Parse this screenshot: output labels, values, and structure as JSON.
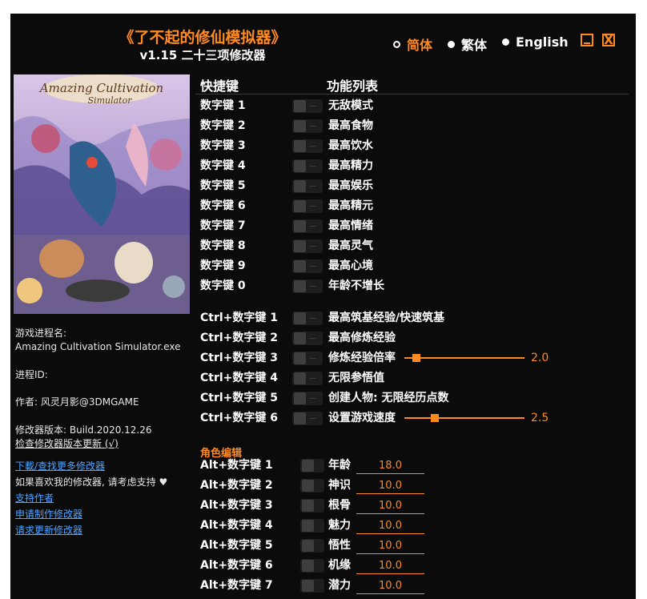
{
  "header": {
    "title": "《了不起的修仙模拟器》",
    "subtitle": "v1.15 二十三项修改器"
  },
  "languages": [
    "简体",
    "繁体",
    "English"
  ],
  "colors": {
    "accent": "#ff8a1e",
    "link": "#4fa3ff",
    "background": "#0b0b0b"
  },
  "window_buttons": {
    "minimize": "minimize-icon",
    "close": "X"
  },
  "cover": {
    "logo_text_1": "Amazing Cultivation",
    "logo_text_2": "Simulator"
  },
  "sidebar": {
    "process_label": "游戏进程名:",
    "process_value": "Amazing Cultivation Simulator.exe",
    "pid_label": "进程ID:",
    "author": "作者: 风灵月影@3DMGAME",
    "version": "修改器版本: Build.2020.12.26",
    "check_update": "检查修改器版本更新 (√)",
    "download_link": "下載/查找更多修改器",
    "support_text": "如果喜欢我的修改器, 请考虑支持",
    "heart_icon": "♥",
    "support_link": "支持作者",
    "request_link": "申请制作修改器",
    "update_link": "请求更新修改器"
  },
  "table": {
    "col_hotkey": "快捷键",
    "col_functions": "功能列表"
  },
  "cheats": [
    {
      "key": "数字键 1",
      "name": "无敌模式"
    },
    {
      "key": "数字键 2",
      "name": "最高食物"
    },
    {
      "key": "数字键 3",
      "name": "最高饮水"
    },
    {
      "key": "数字键 4",
      "name": "最高精力"
    },
    {
      "key": "数字键 5",
      "name": "最高娱乐"
    },
    {
      "key": "数字键 6",
      "name": "最高精元"
    },
    {
      "key": "数字键 7",
      "name": "最高情绪"
    },
    {
      "key": "数字键 8",
      "name": "最高灵气"
    },
    {
      "key": "数字键 9",
      "name": "最高心境"
    },
    {
      "key": "数字键 0",
      "name": "年龄不增长"
    }
  ],
  "ctrl_cheats": [
    {
      "key": "Ctrl+数字键 1",
      "name": "最高筑基经验/快速筑基"
    },
    {
      "key": "Ctrl+数字键 2",
      "name": "最高修炼经验"
    },
    {
      "key": "Ctrl+数字键 3",
      "name": "修炼经验倍率",
      "value": "2.0",
      "level": 0.1
    },
    {
      "key": "Ctrl+数字键 4",
      "name": "无限参悟值"
    },
    {
      "key": "Ctrl+数字键 5",
      "name": "创建人物: 无限经历点数"
    },
    {
      "key": "Ctrl+数字键 6",
      "name": "设置游戏速度",
      "value": "2.5",
      "level": 0.25
    }
  ],
  "edit_section": "角色编辑",
  "alt_cheats": [
    {
      "key": "Alt+数字键 1",
      "name": "年龄",
      "value": "18.0"
    },
    {
      "key": "Alt+数字键 2",
      "name": "神识",
      "value": "10.0"
    },
    {
      "key": "Alt+数字键 3",
      "name": "根骨",
      "value": "10.0"
    },
    {
      "key": "Alt+数字键 4",
      "name": "魅力",
      "value": "10.0"
    },
    {
      "key": "Alt+数字键 5",
      "name": "悟性",
      "value": "10.0"
    },
    {
      "key": "Alt+数字键 6",
      "name": "机缘",
      "value": "10.0"
    },
    {
      "key": "Alt+数字键 7",
      "name": "潜力",
      "value": "10.0"
    }
  ]
}
